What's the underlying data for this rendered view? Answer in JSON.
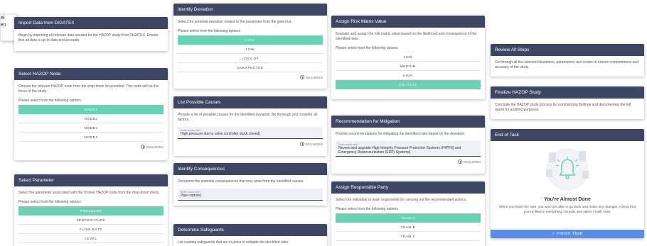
{
  "left_overlay": {
    "lines": [
      "e rel",
      "quen"
    ]
  },
  "import": {
    "title": "Import Data from DIGATEX",
    "desc": "Begin by importing all relevant data needed for the HAZOP study from DIGATEX. Ensure that all data is up-to-date and accurate."
  },
  "node": {
    "title": "Select HAZOP Node",
    "desc": "Choose the relevant HAZOP node from the drop-down list provided. This node will be the focus of the study.",
    "prompt": "Please select from the following options",
    "options": [
      "NODE1",
      "NODE2",
      "NODE3",
      "NODE4"
    ],
    "required": "REQUIRED"
  },
  "parameter": {
    "title": "Select Parameter",
    "desc": "Select the parameter associated with the chosen HAZOP node from the drop-down menu.",
    "prompt": "Please select from the following options",
    "options": [
      "PRESSURE",
      "TEMPERATURE",
      "FLOW RATE",
      "LEVEL"
    ]
  },
  "deviation": {
    "title": "Identify Deviation",
    "desc": "Select the potential deviation related to the parameter from the given list.",
    "prompt": "Please select from the following options",
    "options": [
      "HIGH",
      "LOW",
      "LOSS OF",
      "UNEXPECTED"
    ],
    "required": "REQUIRED"
  },
  "causes": {
    "title": "List Possible Causes",
    "desc": "Provide a list of possible causes for the identified deviation. Be thorough and consider all factors.",
    "field_label": "Enter some text *",
    "field_value": "High pressure due to valve controller stuck closed]",
    "required": "REQUIRED"
  },
  "consequences": {
    "title": "Identify Consequences",
    "desc": "Document the potential consequences that may arise from the identified causes.",
    "field_label": "Enter some text *",
    "field_value": "Pipe rupture]"
  },
  "safeguards": {
    "title": "Determine Safeguards",
    "desc": "List existing safeguards that are in place to mitigate the identified risks."
  },
  "risk": {
    "title": "Assign Risk Matrix Value",
    "desc": "Evaluate and assign the risk matrix value based on the likelihood and consequence of the identified risks.",
    "prompt": "Please select from the following options",
    "options": [
      "LOW",
      "MEDIUM",
      "HIGH",
      "CRITICAL"
    ]
  },
  "mitigation": {
    "title": "Recommendation for Mitigation",
    "desc": "Provide recommendations for mitigating the identified risks based on the deviation.",
    "field_label": "Enter some text *",
    "field_value": "Review and upgrade High-Integrity Pressure Protection Systems (HIPPS) and Emergency Depressurization (EDP) Systems]",
    "required": "REQUIRED"
  },
  "party": {
    "title": "Assign Responsible Party",
    "desc": "Select the individual or team responsible for carrying out the recommended actions.",
    "prompt": "Please select from the following options",
    "options": [
      "TEAM A",
      "TEAM B",
      "TEAM C"
    ]
  },
  "review": {
    "title": "Review All Steps",
    "desc": "Go through all the selected deviations, parameters, and nodes to ensure completeness and accuracy of the study."
  },
  "finalize": {
    "title": "Finalize HAZOP Study",
    "desc": "Conclude the HAZOP study process by summarizing findings and documenting the full report for auditing purposes."
  },
  "end": {
    "title": "End of Task",
    "done_title": "You're Almost Done",
    "done_text": "When you finish the task, you won't be able to go back and make any changes. Check that you've filled in everything correctly and select Finish Task.",
    "finish_label": "FINISH TASK"
  },
  "colors": {
    "header": "#3d4663",
    "selected": "#6ad1b5",
    "finish": "#5b8de6",
    "bell": "#6ad1b5"
  },
  "selected": {
    "node": "NODE1",
    "parameter": "PRESSURE",
    "deviation": "HIGH",
    "risk": "CRITICAL",
    "party": "TEAM A"
  }
}
